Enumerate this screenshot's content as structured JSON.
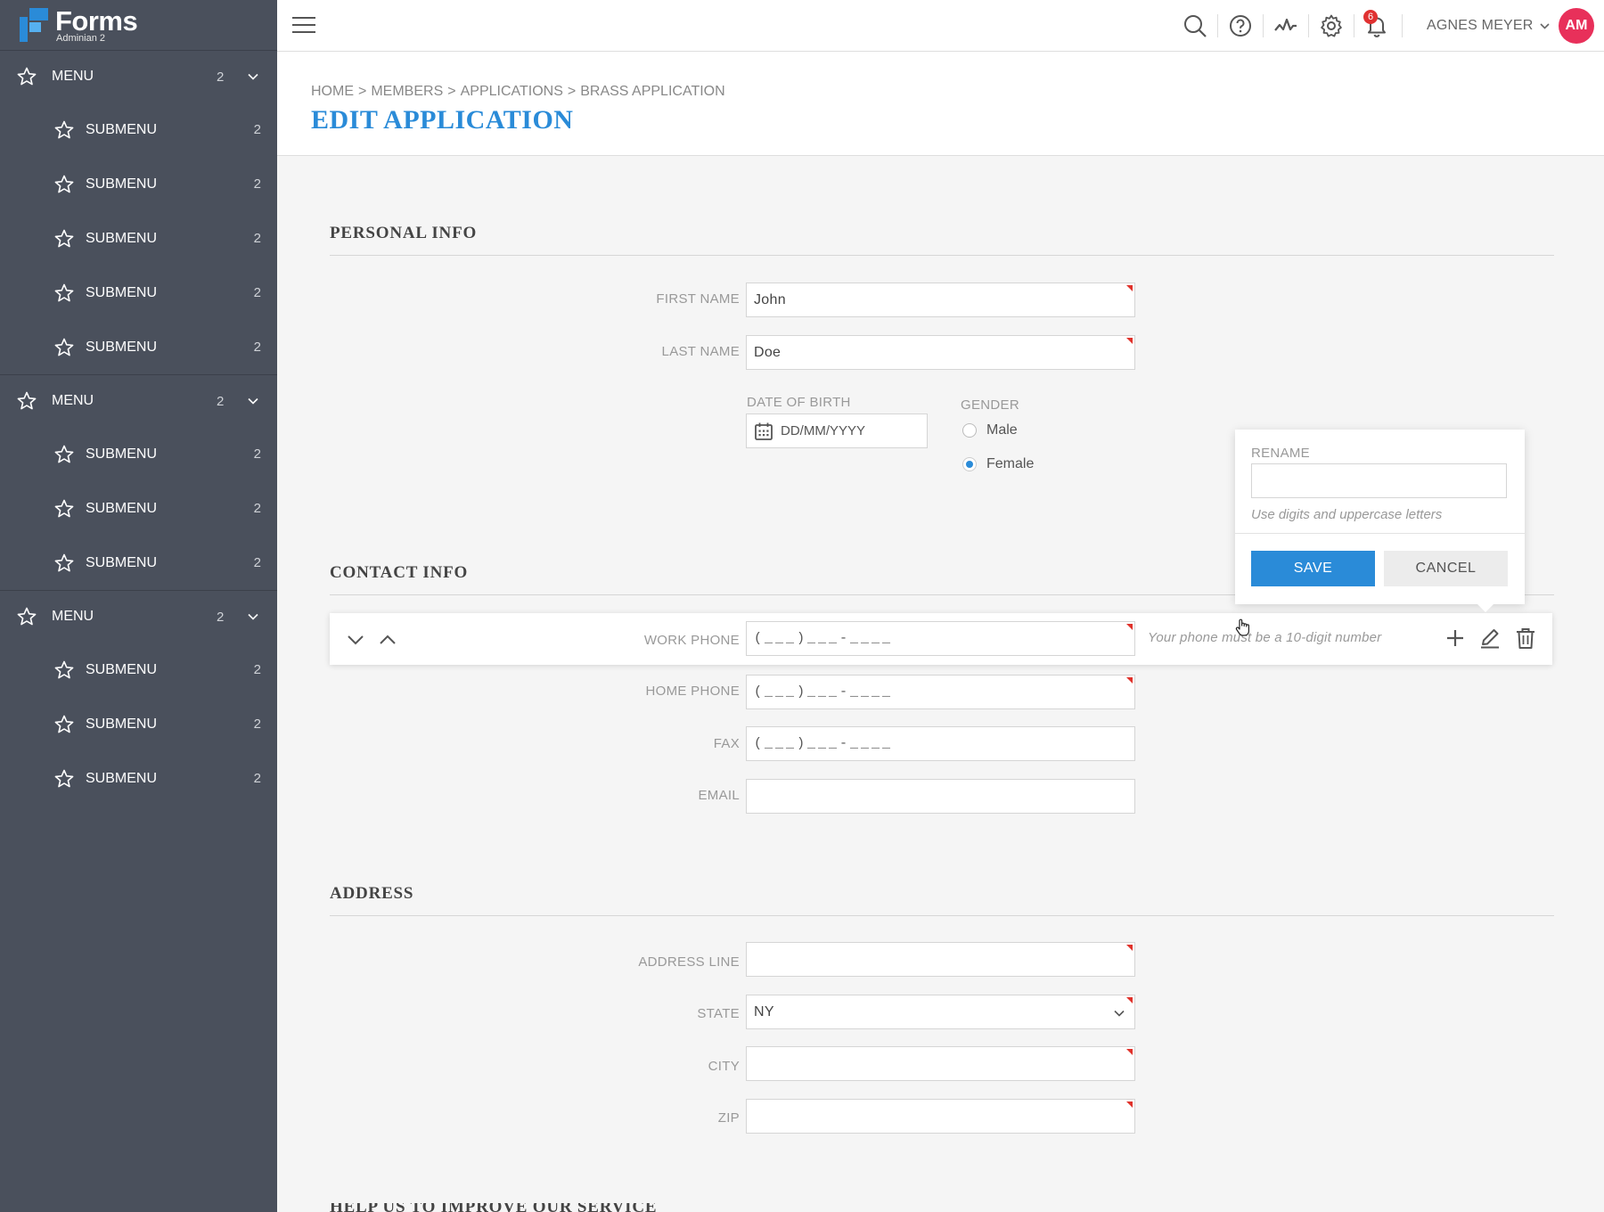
{
  "app": {
    "name": "Forms",
    "subtitle": "Adminian 2"
  },
  "sidebar": {
    "groups": [
      {
        "label": "MENU",
        "count": "2",
        "items": [
          {
            "label": "SUBMENU",
            "count": "2"
          },
          {
            "label": "SUBMENU",
            "count": "2"
          },
          {
            "label": "SUBMENU",
            "count": "2"
          },
          {
            "label": "SUBMENU",
            "count": "2"
          },
          {
            "label": "SUBMENU",
            "count": "2"
          }
        ]
      },
      {
        "label": "MENU",
        "count": "2",
        "items": [
          {
            "label": "SUBMENU",
            "count": "2"
          },
          {
            "label": "SUBMENU",
            "count": "2"
          },
          {
            "label": "SUBMENU",
            "count": "2"
          }
        ]
      },
      {
        "label": "MENU",
        "count": "2",
        "items": [
          {
            "label": "SUBMENU",
            "count": "2"
          },
          {
            "label": "SUBMENU",
            "count": "2"
          },
          {
            "label": "SUBMENU",
            "count": "2"
          }
        ]
      }
    ]
  },
  "topbar": {
    "icons": [
      "menu-icon",
      "search-icon",
      "help-icon",
      "activity-icon",
      "gear-icon",
      "bell-icon"
    ],
    "notification_count": "6",
    "user_name": "AGNES MEYER",
    "avatar_initials": "AM"
  },
  "header": {
    "breadcrumb": [
      "HOME",
      "MEMBERS",
      "APPLICATIONS",
      "BRASS APPLICATION"
    ],
    "breadcrumb_separator": ">",
    "title": "EDIT APPLICATION"
  },
  "personal": {
    "title": "PERSONAL INFO",
    "first_name_label": "FIRST NAME",
    "first_name_value": "John",
    "last_name_label": "LAST NAME",
    "last_name_value": "Doe",
    "dob_label": "DATE OF BIRTH",
    "dob_placeholder": "DD/MM/YYYY",
    "gender_label": "GENDER",
    "gender_male": "Male",
    "gender_female": "Female",
    "gender_selected": "Female"
  },
  "contact": {
    "title": "CONTACT INFO",
    "work_phone_label": "WORK PHONE",
    "home_phone_label": "HOME PHONE",
    "fax_label": "FAX",
    "email_label": "EMAIL",
    "phone_mask": "(___)___-____",
    "phone_hint": "Your phone must be a 10-digit number"
  },
  "rename": {
    "label": "RENAME",
    "value": "",
    "help": "Use digits and uppercase letters",
    "save": "SAVE",
    "cancel": "CANCEL"
  },
  "address": {
    "title": "ADDRESS",
    "line_label": "ADDRESS LINE",
    "state_label": "STATE",
    "state_value": "NY",
    "city_label": "CITY",
    "zip_label": "ZIP"
  },
  "footer_section": {
    "title": "HELP US TO IMPROVE OUR SERVICE"
  },
  "colors": {
    "accent": "#2a8bd8",
    "sidebar": "#4a505c",
    "avatar": "#e8305a",
    "required": "#e0322b"
  }
}
